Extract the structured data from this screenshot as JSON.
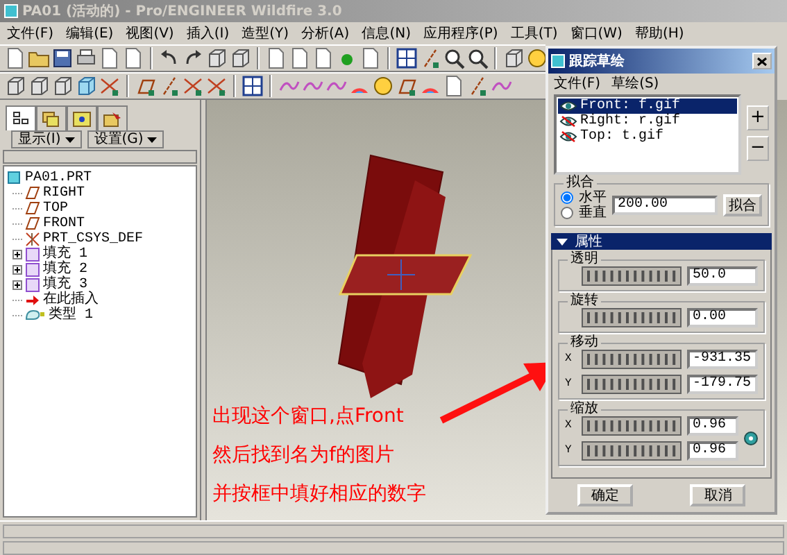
{
  "window": {
    "title": "PA01 (活动的) - Pro/ENGINEER Wildfire 3.0"
  },
  "menu": [
    "文件(F)",
    "编辑(E)",
    "视图(V)",
    "插入(I)",
    "造型(Y)",
    "分析(A)",
    "信息(N)",
    "应用程序(P)",
    "工具(T)",
    "窗口(W)",
    "帮助(H)"
  ],
  "panel_tabs": [
    {
      "selected": true
    },
    {
      "selected": false
    },
    {
      "selected": false
    },
    {
      "selected": false
    }
  ],
  "panel_buttons": [
    "显示(I)",
    "设置(G)"
  ],
  "tree": [
    {
      "label": "PA01.PRT",
      "kind": "part",
      "children": [
        {
          "label": "RIGHT",
          "kind": "plane"
        },
        {
          "label": "TOP",
          "kind": "plane"
        },
        {
          "label": "FRONT",
          "kind": "plane"
        },
        {
          "label": "PRT_CSYS_DEF",
          "kind": "csys"
        },
        {
          "label": "填充 1",
          "kind": "fill",
          "expanded": false
        },
        {
          "label": "填充 2",
          "kind": "fill",
          "expanded": false
        },
        {
          "label": "填充 3",
          "kind": "fill",
          "expanded": false
        },
        {
          "label": "在此插入",
          "kind": "insert"
        },
        {
          "label": "类型 1",
          "kind": "type"
        }
      ]
    }
  ],
  "annotation": [
    "出现这个窗口,点Front",
    "然后找到名为f的图片",
    "并按框中填好相应的数字"
  ],
  "dialog": {
    "title": "跟踪草绘",
    "menu": [
      "文件(F)",
      "草绘(S)"
    ],
    "sketches": [
      {
        "label": "Front: f.gif",
        "visible": true,
        "selected": true
      },
      {
        "label": "Right: r.gif",
        "visible": false,
        "selected": false
      },
      {
        "label": "Top: t.gif",
        "visible": false,
        "selected": false
      }
    ],
    "side_buttons": [
      "+",
      "−"
    ],
    "fit": {
      "title": "拟合",
      "options": [
        {
          "label": "水平",
          "selected": true
        },
        {
          "label": "垂直",
          "selected": false
        }
      ],
      "value": "200.00",
      "button": "拟合"
    },
    "properties": {
      "title": "属性",
      "expanded": true,
      "groups": [
        {
          "title": "透明",
          "rows": [
            {
              "value": "50.0"
            }
          ]
        },
        {
          "title": "旋转",
          "rows": [
            {
              "value": "0.00"
            }
          ]
        },
        {
          "title": "移动",
          "rows": [
            {
              "axis": "X",
              "value": "-931.35"
            },
            {
              "axis": "Y",
              "value": "-179.75"
            }
          ]
        },
        {
          "title": "缩放",
          "rows": [
            {
              "axis": "X",
              "value": "0.96"
            },
            {
              "axis": "Y",
              "value": "0.96"
            }
          ],
          "lock": true
        }
      ]
    },
    "buttons": [
      "确定",
      "取消"
    ]
  }
}
